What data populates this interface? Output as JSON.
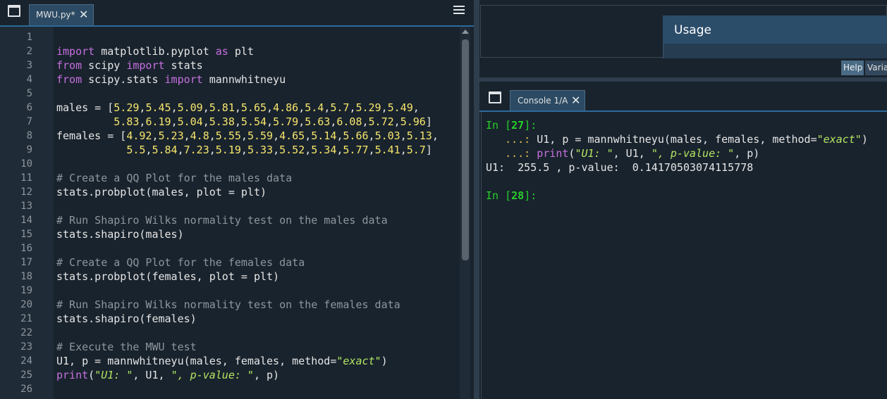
{
  "editor": {
    "tab_label": "MWU.py*",
    "line_numbers": [
      "1",
      "2",
      "3",
      "4",
      "5",
      "6",
      "7",
      "8",
      "9",
      "10",
      "11",
      "12",
      "13",
      "14",
      "15",
      "16",
      "17",
      "18",
      "19",
      "20",
      "21",
      "22",
      "23",
      "24",
      "25",
      "26"
    ],
    "code_lines": [
      [],
      [
        [
          "kw",
          "import"
        ],
        [
          "t",
          " matplotlib.pyplot "
        ],
        [
          "kw",
          "as"
        ],
        [
          "t",
          " plt"
        ]
      ],
      [
        [
          "kw",
          "from"
        ],
        [
          "t",
          " scipy "
        ],
        [
          "kw",
          "import"
        ],
        [
          "t",
          " stats"
        ]
      ],
      [
        [
          "kw",
          "from"
        ],
        [
          "t",
          " scipy.stats "
        ],
        [
          "kw",
          "import"
        ],
        [
          "t",
          " mannwhitneyu"
        ]
      ],
      [],
      [
        [
          "t",
          "males = ["
        ],
        [
          "nm",
          "5.29"
        ],
        [
          "t",
          ","
        ],
        [
          "nm",
          "5.45"
        ],
        [
          "t",
          ","
        ],
        [
          "nm",
          "5.09"
        ],
        [
          "t",
          ","
        ],
        [
          "nm",
          "5.81"
        ],
        [
          "t",
          ","
        ],
        [
          "nm",
          "5.65"
        ],
        [
          "t",
          ","
        ],
        [
          "nm",
          "4.86"
        ],
        [
          "t",
          ","
        ],
        [
          "nm",
          "5.4"
        ],
        [
          "t",
          ","
        ],
        [
          "nm",
          "5.7"
        ],
        [
          "t",
          ","
        ],
        [
          "nm",
          "5.29"
        ],
        [
          "t",
          ","
        ],
        [
          "nm",
          "5.49"
        ],
        [
          "t",
          ","
        ]
      ],
      [
        [
          "t",
          "         "
        ],
        [
          "nm",
          "5.83"
        ],
        [
          "t",
          ","
        ],
        [
          "nm",
          "6.19"
        ],
        [
          "t",
          ","
        ],
        [
          "nm",
          "5.04"
        ],
        [
          "t",
          ","
        ],
        [
          "nm",
          "5.38"
        ],
        [
          "t",
          ","
        ],
        [
          "nm",
          "5.54"
        ],
        [
          "t",
          ","
        ],
        [
          "nm",
          "5.79"
        ],
        [
          "t",
          ","
        ],
        [
          "nm",
          "5.63"
        ],
        [
          "t",
          ","
        ],
        [
          "nm",
          "6.08"
        ],
        [
          "t",
          ","
        ],
        [
          "nm",
          "5.72"
        ],
        [
          "t",
          ","
        ],
        [
          "nm",
          "5.96"
        ],
        [
          "t",
          "]"
        ]
      ],
      [
        [
          "t",
          "females = ["
        ],
        [
          "nm",
          "4.92"
        ],
        [
          "t",
          ","
        ],
        [
          "nm",
          "5.23"
        ],
        [
          "t",
          ","
        ],
        [
          "nm",
          "4.8"
        ],
        [
          "t",
          ","
        ],
        [
          "nm",
          "5.55"
        ],
        [
          "t",
          ","
        ],
        [
          "nm",
          "5.59"
        ],
        [
          "t",
          ","
        ],
        [
          "nm",
          "4.65"
        ],
        [
          "t",
          ","
        ],
        [
          "nm",
          "5.14"
        ],
        [
          "t",
          ","
        ],
        [
          "nm",
          "5.66"
        ],
        [
          "t",
          ","
        ],
        [
          "nm",
          "5.03"
        ],
        [
          "t",
          ","
        ],
        [
          "nm",
          "5.13"
        ],
        [
          "t",
          ","
        ]
      ],
      [
        [
          "t",
          "           "
        ],
        [
          "nm",
          "5.5"
        ],
        [
          "t",
          ","
        ],
        [
          "nm",
          "5.84"
        ],
        [
          "t",
          ","
        ],
        [
          "nm",
          "7.23"
        ],
        [
          "t",
          ","
        ],
        [
          "nm",
          "5.19"
        ],
        [
          "t",
          ","
        ],
        [
          "nm",
          "5.33"
        ],
        [
          "t",
          ","
        ],
        [
          "nm",
          "5.52"
        ],
        [
          "t",
          ","
        ],
        [
          "nm",
          "5.34"
        ],
        [
          "t",
          ","
        ],
        [
          "nm",
          "5.77"
        ],
        [
          "t",
          ","
        ],
        [
          "nm",
          "5.41"
        ],
        [
          "t",
          ","
        ],
        [
          "nm",
          "5.7"
        ],
        [
          "t",
          "]"
        ]
      ],
      [],
      [
        [
          "cm",
          "# Create a QQ Plot for the males data"
        ]
      ],
      [
        [
          "t",
          "stats.probplot(males, plot = plt)"
        ]
      ],
      [],
      [
        [
          "cm",
          "# Run Shapiro Wilks normality test on the males data"
        ]
      ],
      [
        [
          "t",
          "stats.shapiro(males)"
        ]
      ],
      [],
      [
        [
          "cm",
          "# Create a QQ Plot for the females data"
        ]
      ],
      [
        [
          "t",
          "stats.probplot(females, plot = plt)"
        ]
      ],
      [],
      [
        [
          "cm",
          "# Run Shapiro Wilks normality test on the females data"
        ]
      ],
      [
        [
          "t",
          "stats.shapiro(females)"
        ]
      ],
      [],
      [
        [
          "cm",
          "# Execute the MWU test"
        ]
      ],
      [
        [
          "t",
          "U1, p = mannwhitneyu(males, females, method="
        ],
        [
          "st",
          "\"exact\""
        ],
        [
          "t",
          ")"
        ]
      ],
      [
        [
          "bi",
          "print"
        ],
        [
          "t",
          "("
        ],
        [
          "st",
          "\"U1: \""
        ],
        [
          "t",
          ", U1, "
        ],
        [
          "st",
          "\", p-value: \""
        ],
        [
          "t",
          ", p)"
        ]
      ],
      []
    ]
  },
  "help": {
    "usage_title": "Usage",
    "tab_help": "Help",
    "tab_variables": "Varia"
  },
  "console": {
    "tab_label": "Console 1/A",
    "in_27_prefix": "In [",
    "in_27_num": "27",
    "in_27_suffix": "]:",
    "cont1": "   ...: ",
    "cont1_code": "U1, p = mannwhitneyu(males, females, method=",
    "cont1_str": "\"exact\"",
    "cont1_end": ")",
    "cont2": "   ...: ",
    "cont2_print": "print",
    "cont2_open": "(",
    "cont2_str1": "\"U1: \"",
    "cont2_mid": ", U1, ",
    "cont2_str2": "\", p-value: \"",
    "cont2_end": ", p)",
    "output": "U1:  255.5 , p-value:  0.14170503074115778",
    "in_28_prefix": "In [",
    "in_28_num": "28",
    "in_28_suffix": "]:"
  }
}
